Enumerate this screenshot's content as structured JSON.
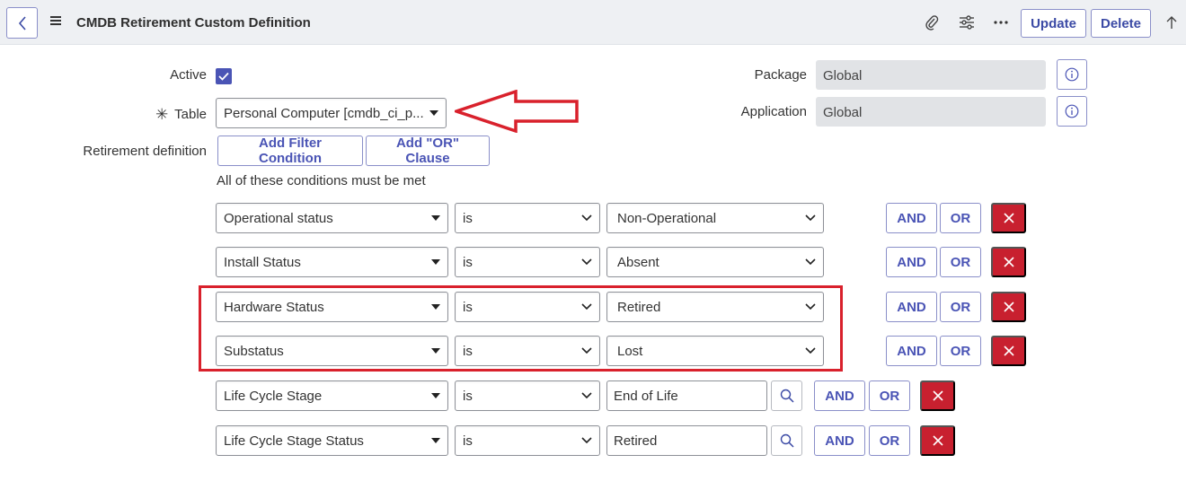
{
  "header": {
    "title": "CMDB Retirement Custom Definition",
    "update_label": "Update",
    "delete_label": "Delete",
    "icons": [
      "back-icon",
      "menu-icon",
      "paperclip-icon",
      "settings-sliders-icon",
      "more-icon",
      "scroll-up-icon"
    ]
  },
  "form": {
    "active_label": "Active",
    "active_checked": true,
    "table_label": "Table",
    "table_value": "Personal Computer [cmdb_ci_p...",
    "retirement_label": "Retirement definition",
    "add_filter_label": "Add Filter Condition",
    "add_or_label": "Add \"OR\" Clause",
    "conditions_note": "All of these conditions must be met",
    "package_label": "Package",
    "package_value": "Global",
    "application_label": "Application",
    "application_value": "Global"
  },
  "conditions": [
    {
      "field": "Operational status",
      "operator": "is",
      "value": "Non-Operational",
      "value_type": "select"
    },
    {
      "field": "Install Status",
      "operator": "is",
      "value": "Absent",
      "value_type": "select"
    },
    {
      "field": "Hardware Status",
      "operator": "is",
      "value": "Retired",
      "value_type": "select"
    },
    {
      "field": "Substatus",
      "operator": "is",
      "value": "Lost",
      "value_type": "select"
    },
    {
      "field": "Life Cycle Stage",
      "operator": "is",
      "value": "End of Life",
      "value_type": "reference"
    },
    {
      "field": "Life Cycle Stage Status",
      "operator": "is",
      "value": "Retired",
      "value_type": "reference"
    }
  ],
  "condition_buttons": {
    "and_label": "AND",
    "or_label": "OR"
  },
  "colors": {
    "accent": "#4a54b5",
    "delete": "#c8202f",
    "annotation": "#d9212c"
  }
}
